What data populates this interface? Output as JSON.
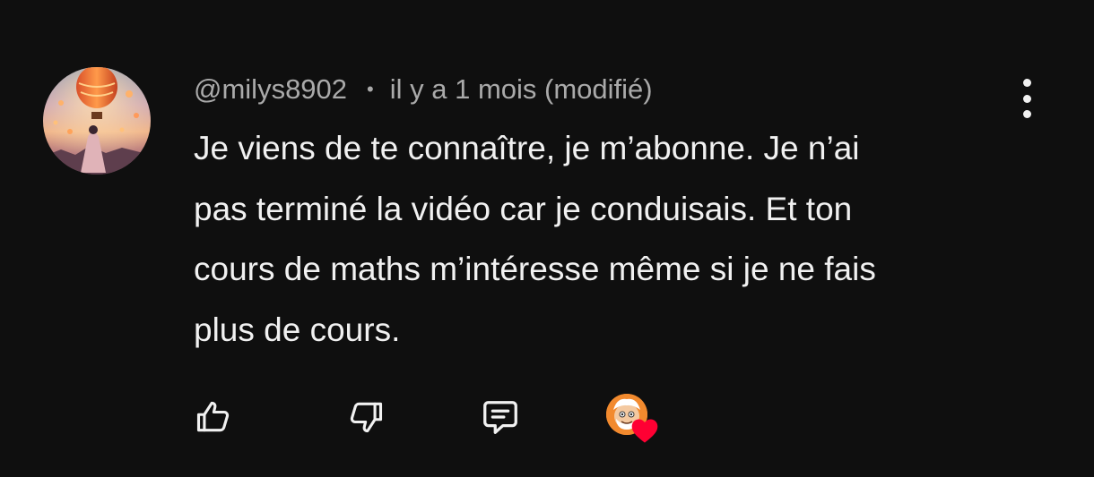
{
  "comment": {
    "author": "@milys8902",
    "separator": "•",
    "timestamp": "il y a 1 mois (modifié)",
    "text": "Je viens de te connaître, je m’abonne. Je n’ai\npas terminé la vidéo car je conduisais. Et ton\ncours de maths m’intéresse même si je ne fais\nplus de cours."
  },
  "actions": {
    "like_icon": "thumbs-up-icon",
    "dislike_icon": "thumbs-down-icon",
    "reply_icon": "comment-reply-icon",
    "menu_icon": "more-vertical-icon",
    "creator_heart_icon": "heart-icon"
  },
  "colors": {
    "background": "#0f0f0f",
    "text": "#f1f1f1",
    "meta": "#aaaaaa",
    "heart": "#ff0033"
  }
}
